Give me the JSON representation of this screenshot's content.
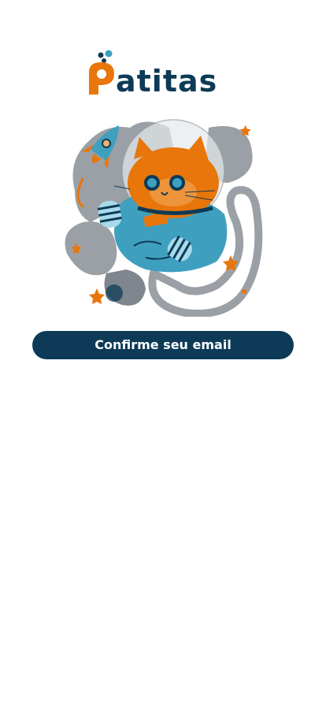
{
  "app": {
    "logo_text": "Patitas"
  },
  "main": {
    "confirm_button_label": "Confirme seu email"
  },
  "colors": {
    "brand_navy": "#0d3b57",
    "brand_orange": "#e8760a",
    "brand_blue": "#3f9fbf",
    "background": "#ffffff"
  },
  "illustration": {
    "subject": "astronaut-cat-with-rocket"
  }
}
